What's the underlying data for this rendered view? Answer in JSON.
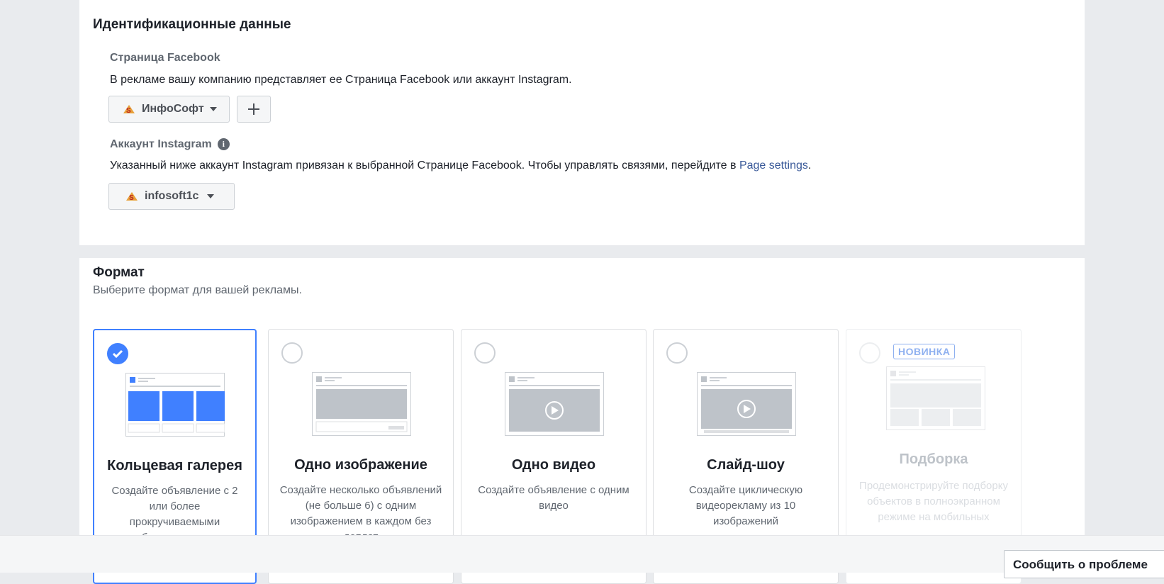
{
  "identity": {
    "title": "Идентификационные данные",
    "facebook_page_label": "Страница Facebook",
    "facebook_page_desc": "В рекламе вашу компанию представляет ее Страница Facebook или аккаунт Instagram.",
    "selected_page": "ИнфоСофт",
    "add_button_icon": "plus-icon",
    "instagram_label": "Аккаунт Instagram",
    "instagram_desc_prefix": "Указанный ниже аккаунт Instagram привязан к выбранной Странице Facebook. Чтобы управлять связями, перейдите в ",
    "instagram_desc_link": "Page settings",
    "instagram_desc_suffix": ".",
    "selected_instagram": "infosoft1c"
  },
  "format": {
    "title": "Формат",
    "subtitle": "Выберите формат для вашей рекламы.",
    "options": [
      {
        "title": "Кольцевая галерея",
        "desc": "Создайте объявление с 2 или более прокручиваемыми изображениями или",
        "selected": true
      },
      {
        "title": "Одно изображение",
        "desc": "Создайте несколько объявлений (не больше 6) с одним изображением в каждом без доплат",
        "selected": false
      },
      {
        "title": "Одно видео",
        "desc": "Создайте объявление с одним видео",
        "selected": false
      },
      {
        "title": "Слайд-шоу",
        "desc": "Создайте циклическую видеорекламу из 10 изображений",
        "selected": false
      },
      {
        "title": "Подборка",
        "desc": "Продемонстрируйте подборку объектов в полноэкранном режиме на мобильных",
        "selected": false,
        "disabled": true,
        "badge": "НОВИНКА"
      }
    ]
  },
  "footer": {
    "report_button": "Сообщить о проблеме"
  },
  "colors": {
    "accent": "#4080ff",
    "link": "#385898",
    "background": "#e9ebee"
  }
}
